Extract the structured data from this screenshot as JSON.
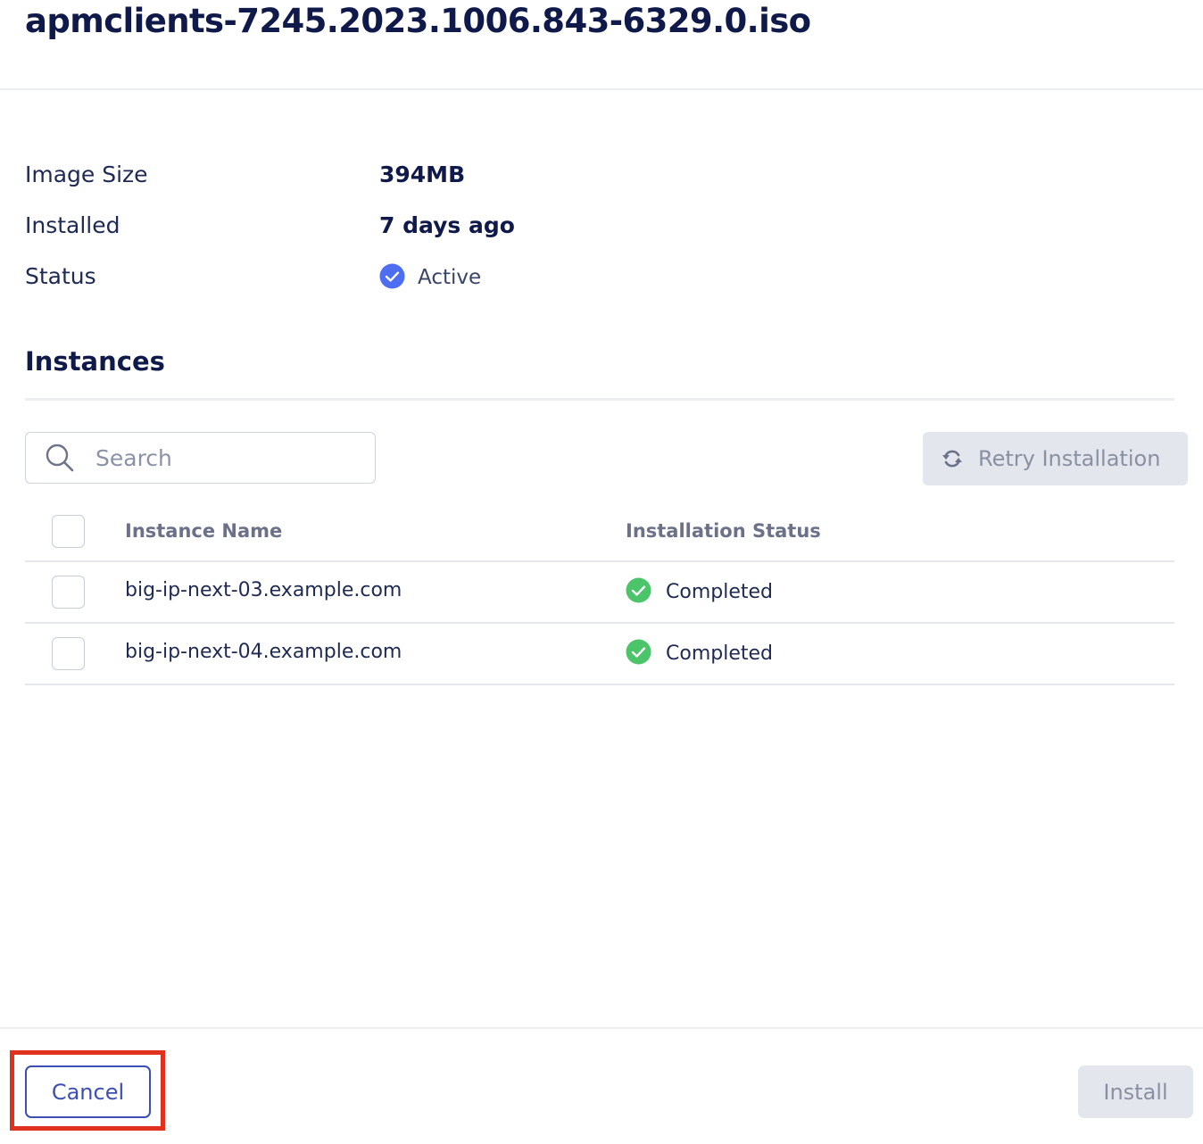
{
  "header": {
    "title": "apmclients-7245.2023.1006.843-6329.0.iso"
  },
  "properties": {
    "image_size_label": "Image Size",
    "image_size_value": "394MB",
    "installed_label": "Installed",
    "installed_value": "7 days ago",
    "status_label": "Status",
    "status_value": "Active",
    "status_icon": "check-circle-icon",
    "status_color": "#4e6ef2"
  },
  "instances": {
    "title": "Instances",
    "search_placeholder": "Search",
    "search_value": "",
    "retry_label": "Retry Installation",
    "retry_icon": "retry-icon",
    "columns": {
      "name": "Instance Name",
      "status": "Installation Status"
    },
    "rows": [
      {
        "name": "big-ip-next-03.example.com",
        "status": "Completed",
        "status_icon": "check-circle-icon",
        "status_color": "#4cc46a"
      },
      {
        "name": "big-ip-next-04.example.com",
        "status": "Completed",
        "status_icon": "check-circle-icon",
        "status_color": "#4cc46a"
      }
    ]
  },
  "footer": {
    "cancel_label": "Cancel",
    "install_label": "Install"
  },
  "colors": {
    "primary": "#3d4fb5",
    "highlight": "#e0301e",
    "disabled_bg": "#e3e6ec"
  }
}
